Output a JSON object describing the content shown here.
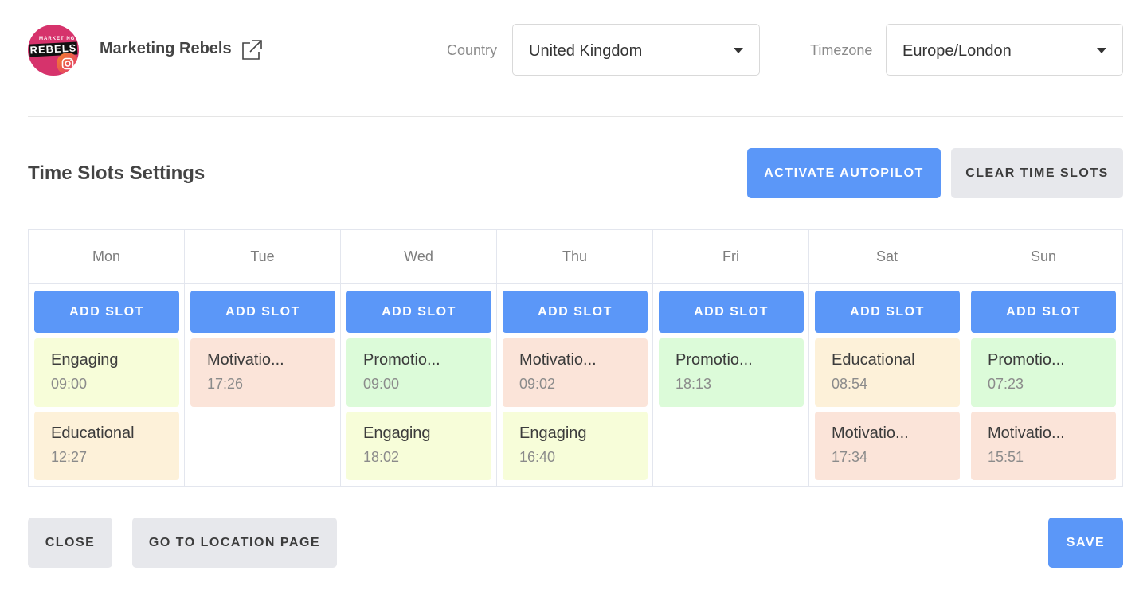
{
  "account": {
    "name": "Marketing Rebels",
    "avatar_top_text": "MARKETING",
    "avatar_brand": "REBELS"
  },
  "country": {
    "label": "Country",
    "value": "United Kingdom"
  },
  "timezone": {
    "label": "Timezone",
    "value": "Europe/London"
  },
  "section": {
    "title": "Time Slots Settings"
  },
  "actions": {
    "activate": "ACTIVATE AUTOPILOT",
    "clear": "CLEAR TIME SLOTS",
    "add_slot": "ADD SLOT"
  },
  "footer": {
    "close": "CLOSE",
    "location": "GO TO LOCATION PAGE",
    "save": "SAVE"
  },
  "colors": {
    "Engaging": "#f7fdd9",
    "Educational": "#fdf1d9",
    "Motivational": "#fbe4d9",
    "Promotional": "#dcfbd9",
    "primary": "#5b97f8"
  },
  "days": [
    {
      "label": "Mon",
      "slots": [
        {
          "cat": "Engaging",
          "kind": "Engaging",
          "time": "09:00"
        },
        {
          "cat": "Educational",
          "kind": "Educational",
          "time": "12:27"
        }
      ]
    },
    {
      "label": "Tue",
      "slots": [
        {
          "cat": "Motivatio...",
          "kind": "Motivational",
          "time": "17:26"
        }
      ]
    },
    {
      "label": "Wed",
      "slots": [
        {
          "cat": "Promotio...",
          "kind": "Promotional",
          "time": "09:00"
        },
        {
          "cat": "Engaging",
          "kind": "Engaging",
          "time": "18:02"
        }
      ]
    },
    {
      "label": "Thu",
      "slots": [
        {
          "cat": "Motivatio...",
          "kind": "Motivational",
          "time": "09:02"
        },
        {
          "cat": "Engaging",
          "kind": "Engaging",
          "time": "16:40"
        }
      ]
    },
    {
      "label": "Fri",
      "slots": [
        {
          "cat": "Promotio...",
          "kind": "Promotional",
          "time": "18:13"
        }
      ]
    },
    {
      "label": "Sat",
      "slots": [
        {
          "cat": "Educational",
          "kind": "Educational",
          "time": "08:54"
        },
        {
          "cat": "Motivatio...",
          "kind": "Motivational",
          "time": "17:34"
        }
      ]
    },
    {
      "label": "Sun",
      "slots": [
        {
          "cat": "Promotio...",
          "kind": "Promotional",
          "time": "07:23"
        },
        {
          "cat": "Motivatio...",
          "kind": "Motivational",
          "time": "15:51"
        }
      ]
    }
  ]
}
